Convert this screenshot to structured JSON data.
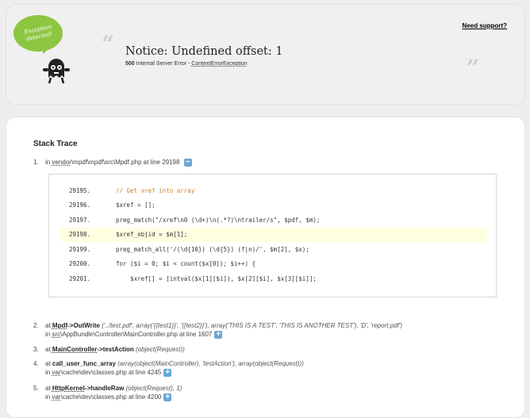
{
  "header": {
    "support_link": "Need support?",
    "bubble_text": "Exception detected!",
    "title": "Notice: Undefined offset: 1",
    "status_code": "500",
    "status_text": "Internal Server Error -",
    "exception_class": "ContextErrorException",
    "open_quote": "“",
    "close_quote": "”"
  },
  "stack": {
    "title": "Stack Trace",
    "items": [
      {
        "num": "1.",
        "prefix": "in",
        "path": "vendor",
        "rest": "\\mpdf\\mpdf\\src\\Mpdf.php at line 29198",
        "toggle": "−"
      },
      {
        "num": "2.",
        "prefix": "at",
        "class": "Mpdf",
        "method": "->OutWrite",
        "args": "('../test.pdf', array('{{test1}}', '{{test2}}'), array('THIS IS A TEST', 'THIS IS ANOTHER TEST'), 'D', 'report.pdf')",
        "prefix2": "in",
        "path": "src",
        "rest": "\\AppBundle\\Controller\\MainController.php at line 1607",
        "toggle": "+"
      },
      {
        "num": "3.",
        "prefix": "at",
        "class": "MainController",
        "method": "->testAction",
        "args": "(object(Request))"
      },
      {
        "num": "4.",
        "prefix": "at",
        "method": "call_user_func_array",
        "args": "(array(object(MainController), 'testAction'), array(object(Request)))",
        "prefix2": "in",
        "path": "var",
        "rest": "\\cache\\dev\\classes.php at line 4245",
        "toggle": "+"
      },
      {
        "num": "5.",
        "prefix": "at",
        "class": "HttpKernel",
        "method": "->handleRaw",
        "args": "(object(Request), 1)",
        "prefix2": "in",
        "path": "var",
        "rest": "\\cache\\dev\\classes.php at line 4200",
        "toggle": "+"
      }
    ]
  },
  "code": {
    "lines": [
      {
        "num": "29195.",
        "src": "// Get xref into array",
        "comment": true
      },
      {
        "num": "29196.",
        "src": "$xref = [];"
      },
      {
        "num": "29197.",
        "src": "preg_match(\"/xref\\n0 (\\d+)\\n(.*?)\\ntrailer/s\", $pdf, $m);"
      },
      {
        "num": "29198.",
        "src": "$xref_objid = $m[1];",
        "highlight": true
      },
      {
        "num": "29199.",
        "src": "preg_match_all('/(\\d{10}) (\\d{5}) (f|n)/', $m[2], $x);"
      },
      {
        "num": "29200.",
        "src": "for ($i = 0; $i < count($x[0]); $i++) {"
      },
      {
        "num": "29201.",
        "src": "    $xref[] = [intval($x[1][$i]), $x[2][$i], $x[3][$i]];"
      }
    ]
  }
}
